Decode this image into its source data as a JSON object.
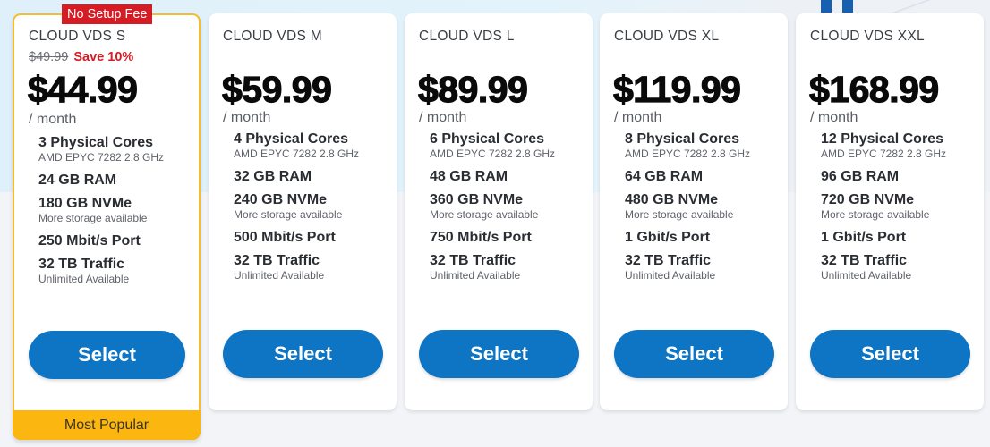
{
  "plans": [
    {
      "name": "CLOUD VDS S",
      "old_price": "$49.99",
      "save": "Save 10%",
      "price": "$44.99",
      "period": "/ month",
      "ribbon": "No Setup Fee",
      "footer": "Most Popular",
      "features": [
        {
          "main": "3 Physical Cores",
          "sub": "AMD EPYC 7282 2.8 GHz"
        },
        {
          "main": "24 GB RAM",
          "sub": ""
        },
        {
          "main": "180 GB NVMe",
          "sub": "More storage available"
        },
        {
          "main": "250 Mbit/s Port",
          "sub": ""
        },
        {
          "main": "32 TB Traffic",
          "sub": "Unlimited Available"
        }
      ],
      "button": "Select"
    },
    {
      "name": "CLOUD VDS M",
      "price": "$59.99",
      "period": "/ month",
      "features": [
        {
          "main": "4 Physical Cores",
          "sub": "AMD EPYC 7282 2.8 GHz"
        },
        {
          "main": "32 GB RAM",
          "sub": ""
        },
        {
          "main": "240 GB NVMe",
          "sub": "More storage available"
        },
        {
          "main": "500 Mbit/s Port",
          "sub": ""
        },
        {
          "main": "32 TB Traffic",
          "sub": "Unlimited Available"
        }
      ],
      "button": "Select"
    },
    {
      "name": "CLOUD VDS L",
      "price": "$89.99",
      "period": "/ month",
      "features": [
        {
          "main": "6 Physical Cores",
          "sub": "AMD EPYC 7282 2.8 GHz"
        },
        {
          "main": "48 GB RAM",
          "sub": ""
        },
        {
          "main": "360 GB NVMe",
          "sub": "More storage available"
        },
        {
          "main": "750 Mbit/s Port",
          "sub": ""
        },
        {
          "main": "32 TB Traffic",
          "sub": "Unlimited Available"
        }
      ],
      "button": "Select"
    },
    {
      "name": "CLOUD VDS XL",
      "price": "$119.99",
      "period": "/ month",
      "features": [
        {
          "main": "8 Physical Cores",
          "sub": "AMD EPYC 7282 2.8 GHz"
        },
        {
          "main": "64 GB RAM",
          "sub": ""
        },
        {
          "main": "480 GB NVMe",
          "sub": "More storage available"
        },
        {
          "main": "1 Gbit/s Port",
          "sub": ""
        },
        {
          "main": "32 TB Traffic",
          "sub": "Unlimited Available"
        }
      ],
      "button": "Select"
    },
    {
      "name": "CLOUD VDS XXL",
      "price": "$168.99",
      "period": "/ month",
      "features": [
        {
          "main": "12 Physical Cores",
          "sub": "AMD EPYC 7282 2.8 GHz"
        },
        {
          "main": "96 GB RAM",
          "sub": ""
        },
        {
          "main": "720 GB NVMe",
          "sub": "More storage available"
        },
        {
          "main": "1 Gbit/s Port",
          "sub": ""
        },
        {
          "main": "32 TB Traffic",
          "sub": "Unlimited Available"
        }
      ],
      "button": "Select"
    }
  ],
  "colors": {
    "accent_button": "#0d75c3",
    "popular_border": "#f6bc2b",
    "popular_footer": "#fbb60f",
    "ribbon": "#d51c24",
    "save_text": "#d51c24"
  }
}
